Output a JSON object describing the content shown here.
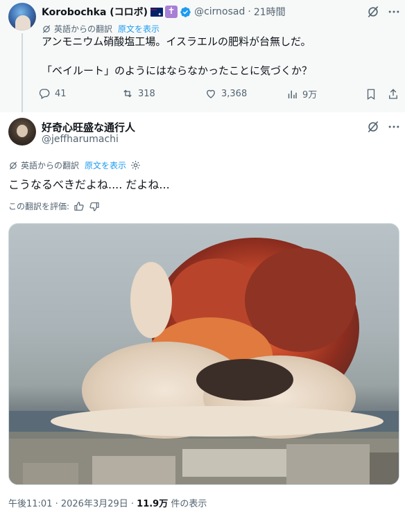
{
  "parent_tweet": {
    "display_name": "Korobochka (コロボ)",
    "handle": "@cirnosad",
    "separator": "·",
    "time": "21時間",
    "translation_label": "英語からの翻訳",
    "show_original": "原文を表示",
    "text_line1": "アンモニウム硝酸塩工場。イスラエルの肥料が台無しだ。",
    "text_line2": "「ベイルート」のようにはならなかったことに気づくか？",
    "replies": "41",
    "reposts": "318",
    "likes": "3,368",
    "views": "9万"
  },
  "main_tweet": {
    "display_name": "好奇心旺盛な通行人",
    "handle": "@jeffharumachi",
    "translation_label": "英語からの翻訳",
    "show_original": "原文を表示",
    "text": "こうなるべきだよね.... だよね...",
    "rate_translation": "この翻訳を評価:",
    "media_description": "explosion-video-thumbnail",
    "timestamp": "午後11:01 · 2026年3月29日 · ",
    "views_count": "11.9万",
    "views_label": " 件の表示"
  },
  "colors": {
    "accent": "#1d9bf0",
    "secondary_text": "#536471",
    "parent_bg": "#f7f9f9",
    "thread_line": "#cfd9de"
  }
}
